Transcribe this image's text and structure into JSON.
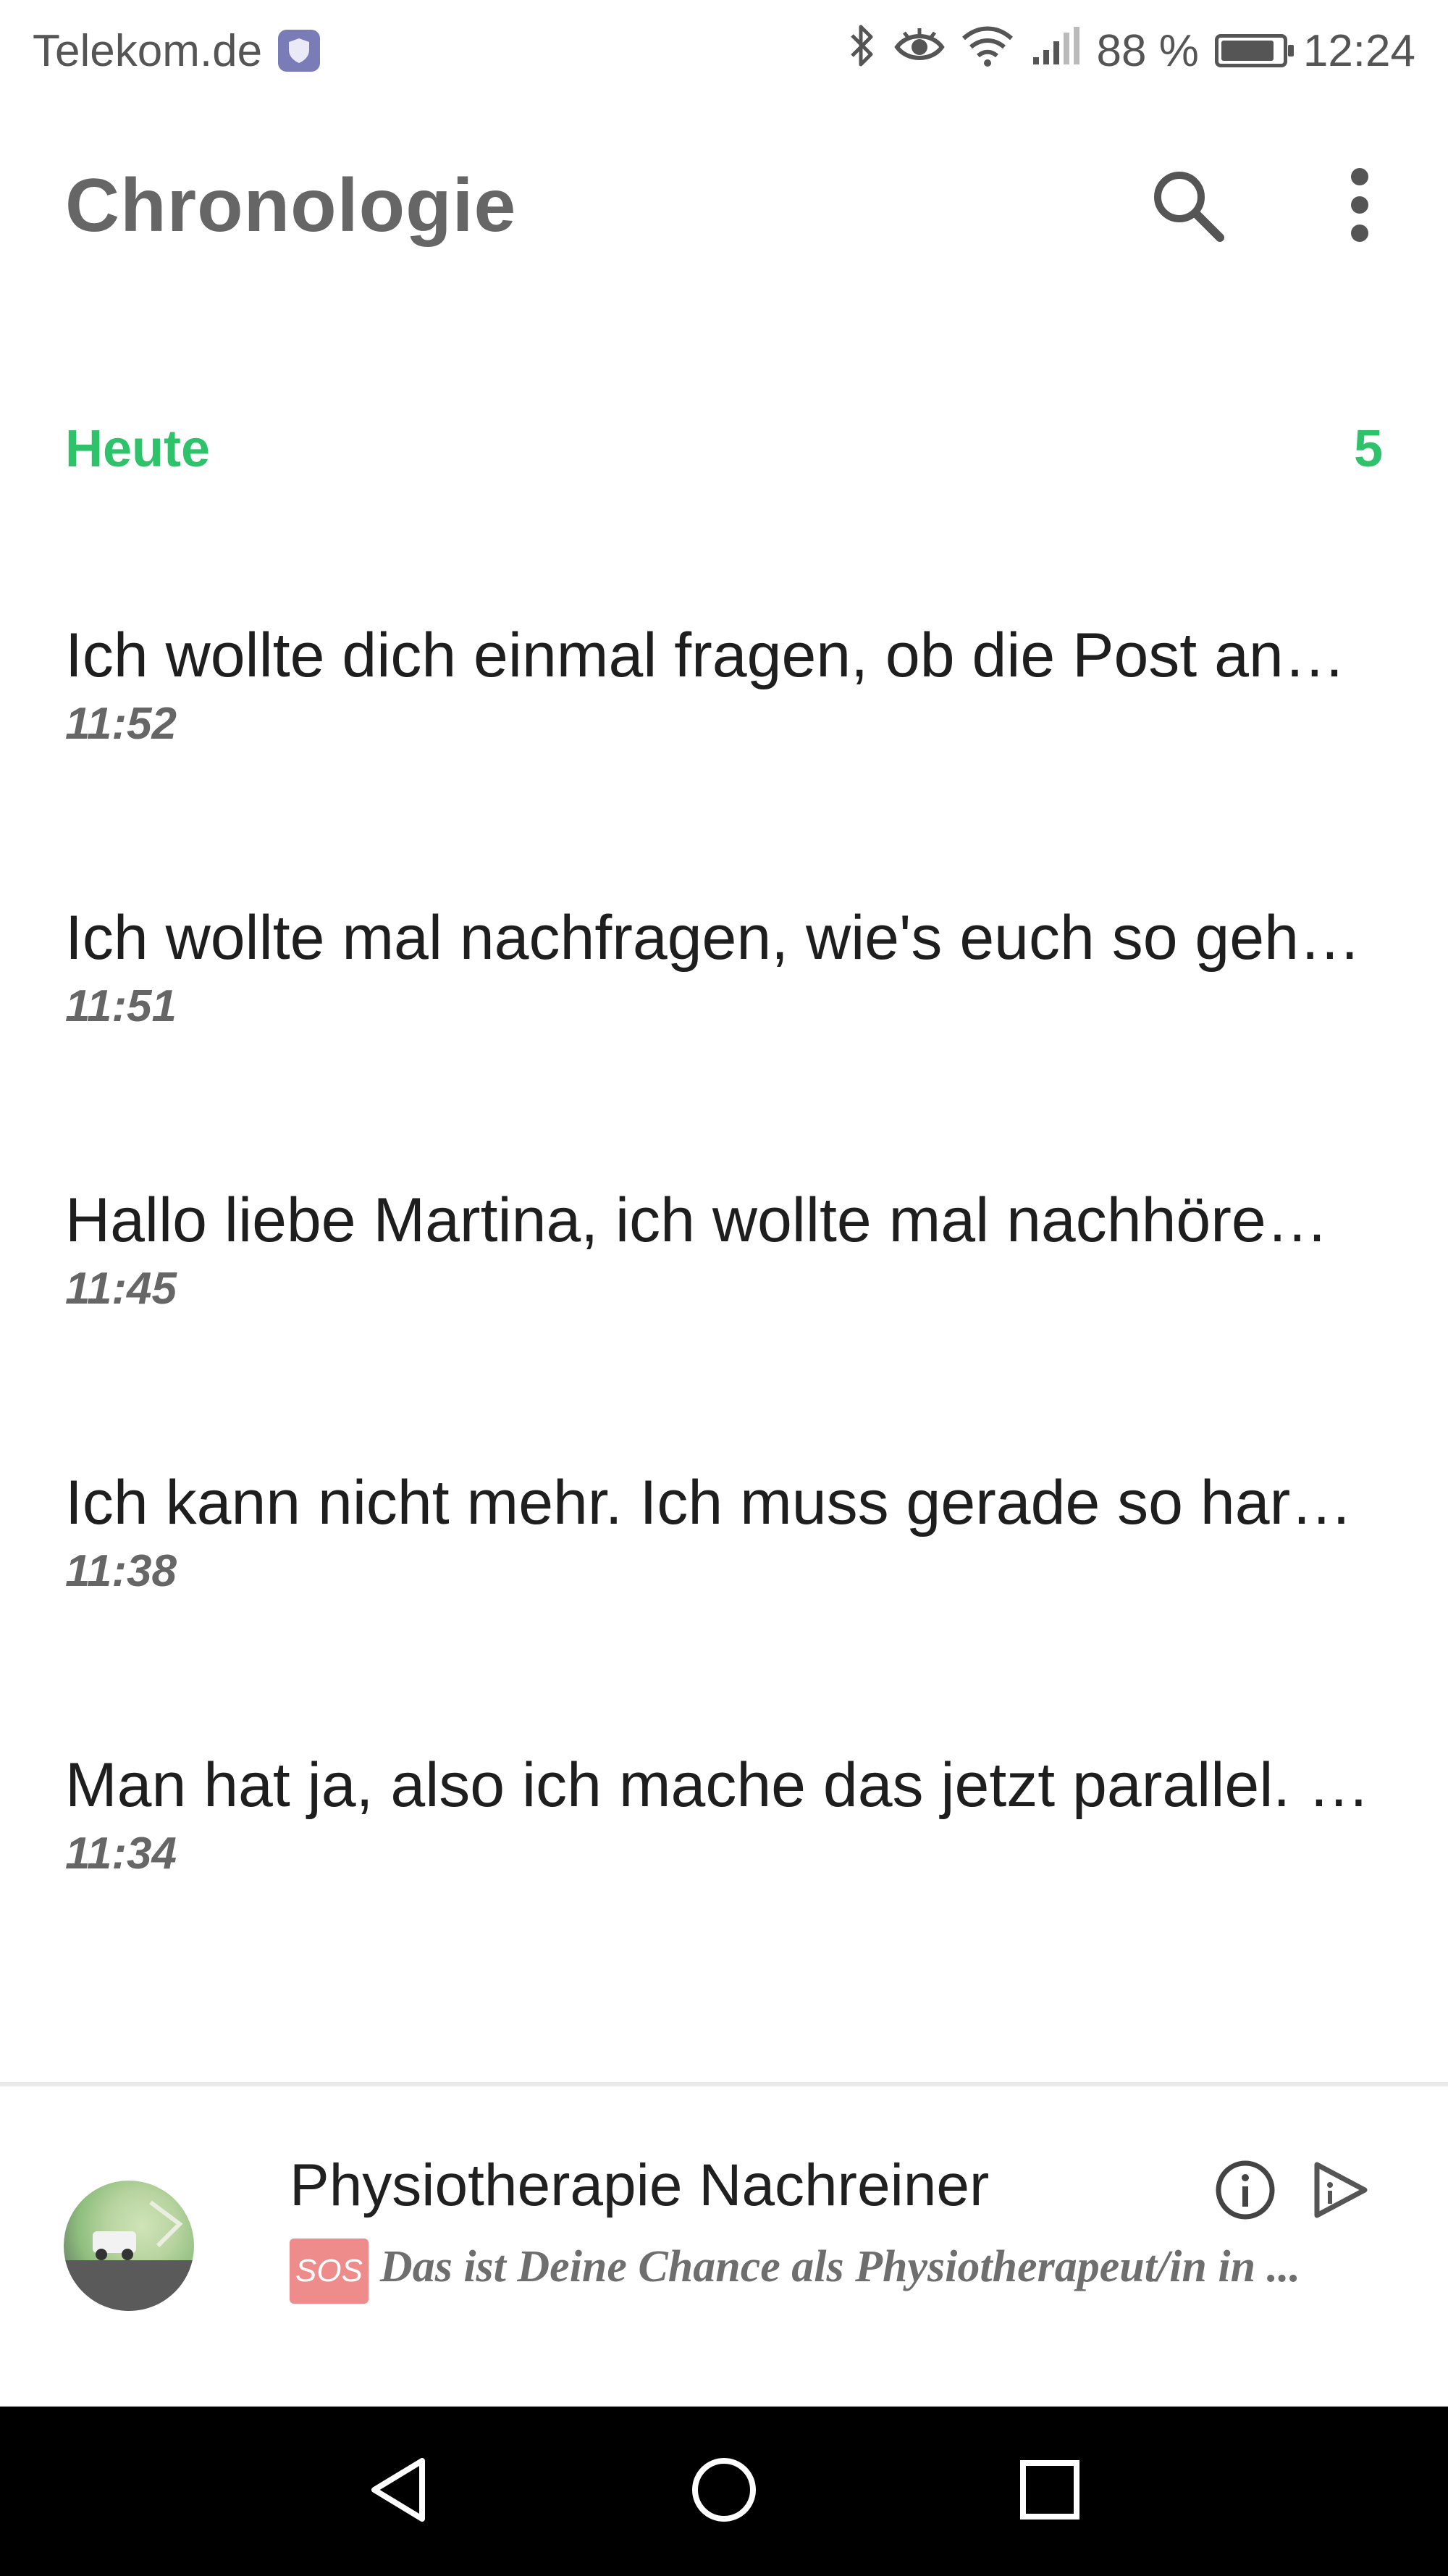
{
  "status_bar": {
    "carrier": "Telekom.de",
    "battery_percent": "88 %",
    "battery_level": 0.88,
    "time": "12:24",
    "icons": [
      "shield-icon",
      "bluetooth-icon",
      "eye-icon",
      "wifi-icon",
      "signal-icon",
      "battery-icon"
    ]
  },
  "app_bar": {
    "title": "Chronologie",
    "icons": [
      "search-icon",
      "more-vert-icon"
    ]
  },
  "section": {
    "label": "Heute",
    "count": "5",
    "accent_color": "#2ec36b"
  },
  "recordings": [
    {
      "text": "Ich wollte dich einmal fragen, ob die Post an…",
      "time": "11:52"
    },
    {
      "text": "Ich wollte mal nachfragen, wie's euch so geh…",
      "time": "11:51"
    },
    {
      "text": "Hallo liebe Martina, ich wollte mal nachhöre…",
      "time": "11:45"
    },
    {
      "text": "Ich kann nicht mehr. Ich muss gerade so har…",
      "time": "11:38"
    },
    {
      "text": "Man hat ja, also ich mache das jetzt parallel. …",
      "time": "11:34"
    }
  ],
  "ad": {
    "title": "Physiotherapie Nachreiner",
    "badge": "SOS",
    "body": "Das ist Deine Chance als Physiotherapeut/in in ...",
    "icons": [
      "info-icon",
      "ad-choices-icon"
    ]
  },
  "nav_bar": {
    "icons": [
      "back-icon",
      "home-icon",
      "recents-icon"
    ]
  }
}
